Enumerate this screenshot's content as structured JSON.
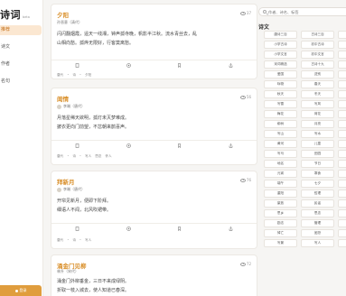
{
  "app": {
    "logo": "诗词",
    "beta": "beta"
  },
  "sidebar": {
    "items": [
      {
        "label": "推荐",
        "active": true
      },
      {
        "label": "诗文",
        "active": false
      },
      {
        "label": "作者",
        "active": false
      },
      {
        "label": "名句",
        "active": false
      }
    ],
    "login_label": "登录"
  },
  "search": {
    "placeholder": "作者、诗名、标签"
  },
  "categories": {
    "title": "诗文",
    "items": [
      "唐诗三百",
      "古诗三百",
      "宋",
      "小学古诗",
      "初中古诗",
      "高",
      "小学文言",
      "初中文言",
      "高",
      "宋词精选",
      "古诗十九",
      "元",
      "爱国",
      "送别",
      "思",
      "咏物",
      "春天",
      "夏",
      "秋天",
      "冬天",
      "雨",
      "写雪",
      "写风",
      "写",
      "梅花",
      "荷花",
      "菊",
      "柳树",
      "月亮",
      "山",
      "写山",
      "写水",
      "长",
      "黄河",
      "儿童",
      "鸟",
      "写马",
      "田园",
      "边",
      "地名",
      "节日",
      "春",
      "元宵",
      "寒食",
      "端",
      "端午",
      "七夕",
      "中",
      "重阳",
      "哲理",
      "婉",
      "豪放",
      "民谣",
      "战",
      "思乡",
      "思念",
      "离",
      "励志",
      "管理",
      "友",
      "悼亡",
      "闺怨",
      "怀",
      "写景",
      "写人",
      "宴"
    ]
  },
  "feed": [
    {
      "title": "夕阳",
      "views": "37",
      "author": "孙晋意（清代）",
      "lines": [
        "闪闪翻烟霞，遥天一线湘，钟声孤寺晚，帆影半江秋。流水青丝去，乱",
        "山相向愁。孤烨无限好，行客莫离愁。"
      ],
      "tags": []
    },
    {
      "title": "闺情",
      "views": "56",
      "author": "李端（唐代）",
      "lines": [
        "月落星稀天欲明，孤灯未灭梦难成。",
        "披衣更向门前望，不忿朝来鹊喜声。"
      ],
      "tags": [
        "唐代",
        "诗",
        "写人",
        "思念",
        "怀人"
      ]
    },
    {
      "title": "拜新月",
      "views": "76",
      "author": "李端（唐代）",
      "lines": [
        "开帘见新月，便即下阶拜。",
        "细语人不闻，北风吹裙带。"
      ],
      "tags": [
        "唐代",
        "诗",
        "写人"
      ]
    },
    {
      "title": "涌金门见柳",
      "views": "72",
      "author": "林升（宋代）",
      "lines": [
        "涌金门外柳垂金，三日不来成绿阴。",
        "折取一枝入城去，使人知道已春深。"
      ],
      "tags": []
    }
  ]
}
